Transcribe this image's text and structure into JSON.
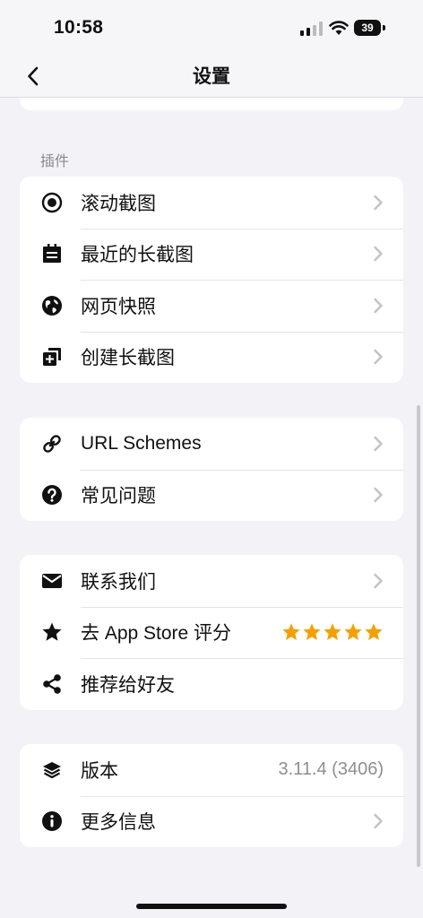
{
  "status": {
    "time": "10:58",
    "battery": "39"
  },
  "nav": {
    "title": "设置"
  },
  "plugins_header": "插件",
  "plugins": [
    {
      "label": "滚动截图",
      "icon": "record-circle-icon"
    },
    {
      "label": "最近的长截图",
      "icon": "calendar-icon"
    },
    {
      "label": "网页快照",
      "icon": "globe-icon"
    },
    {
      "label": "创建长截图",
      "icon": "add-copy-icon"
    }
  ],
  "tools": [
    {
      "label": "URL Schemes",
      "icon": "link-icon"
    },
    {
      "label": "常见问题",
      "icon": "question-circle-icon"
    }
  ],
  "social": [
    {
      "label": "联系我们",
      "icon": "mail-icon"
    },
    {
      "label": "去 App Store 评分",
      "icon": "star-icon",
      "rating": 5
    },
    {
      "label": "推荐给好友",
      "icon": "share-icon"
    }
  ],
  "about": [
    {
      "label": "版本",
      "icon": "layers-icon",
      "value": "3.11.4 (3406)"
    },
    {
      "label": "更多信息",
      "icon": "info-circle-icon"
    }
  ],
  "colors": {
    "background": "#f2f2f7",
    "card": "#ffffff",
    "star": "#f5a000",
    "chevron": "#c4c4c8"
  }
}
